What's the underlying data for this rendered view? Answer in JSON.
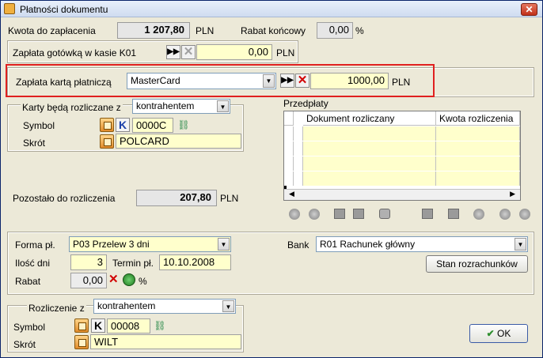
{
  "window": {
    "title": "Płatności dokumentu",
    "close_glyph": "✕"
  },
  "amount_due": {
    "label": "Kwota do zapłacenia",
    "value": "1 207,80",
    "currency": "PLN"
  },
  "final_discount": {
    "label": "Rabat końcowy",
    "value": "0,00",
    "unit": "%"
  },
  "cash": {
    "label": "Zapłata gotówką w kasie K01",
    "value": "0,00",
    "currency": "PLN"
  },
  "card": {
    "label": "Zapłata kartą płatniczą",
    "selected": "MasterCard",
    "value": "1000,00",
    "currency": "PLN"
  },
  "card_settlement": {
    "label": "Karty będą rozliczane z",
    "selected": "kontrahentem",
    "symbol_label": "Symbol",
    "k_label": "K",
    "symbol_value": "0000C",
    "short_label": "Skrót",
    "short_value": "POLCARD"
  },
  "prepayments": {
    "label": "Przedpłaty",
    "columns": [
      "Dokument rozliczany",
      "Kwota rozliczenia"
    ]
  },
  "remaining": {
    "label": "Pozostało do rozliczenia",
    "value": "207,80",
    "currency": "PLN"
  },
  "payment_form": {
    "label": "Forma pł.",
    "selected": "P03 Przelew 3 dni"
  },
  "days": {
    "label": "Ilość dni",
    "value": "3"
  },
  "due_date": {
    "label": "Termin pł.",
    "value": "10.10.2008"
  },
  "discount": {
    "label": "Rabat",
    "value": "0,00",
    "unit": "%"
  },
  "bank": {
    "label": "Bank",
    "selected": "R01 Rachunek główny",
    "balance_button": "Stan rozrachunków"
  },
  "settlement": {
    "label": "Rozliczenie z",
    "selected": "kontrahentem",
    "symbol_label": "Symbol",
    "k_label": "K",
    "symbol_value": "00008",
    "short_label": "Skrót",
    "short_value": "WILT"
  },
  "ok_button": {
    "label": "OK",
    "check_glyph": "✔"
  },
  "colors": {
    "highlight": "#e02020",
    "field_bg": "#ffffcc"
  }
}
